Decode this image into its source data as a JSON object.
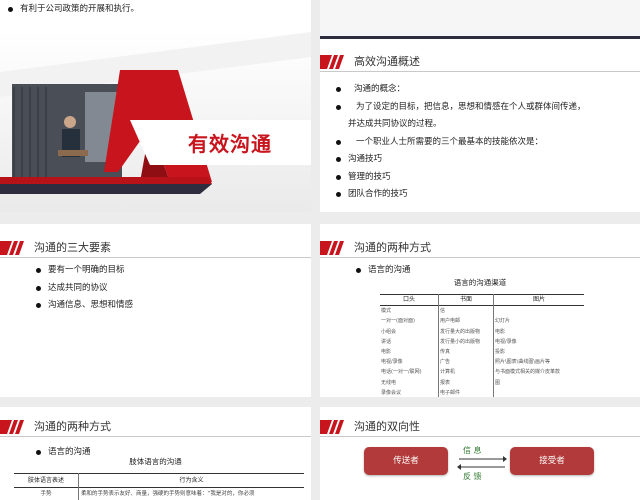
{
  "colors": {
    "accent": "#c8141c",
    "dark": "#2d2d3f",
    "button": "#b23a3a",
    "arrow": "#2f7a2f"
  },
  "s1": {
    "bullet": "有利于公司政策的开展和执行。"
  },
  "s2": {
    "title": "有效沟通"
  },
  "s3": {
    "title": "高效沟通概述",
    "lines": [
      "沟通的概念：",
      "为了设定的目标，把信息，思想和情感在个人或群体间传递，",
      "并达成共同协议的过程。",
      "一个职业人士所需要的三个最基本的技能依次是：",
      "沟通技巧",
      "管理的技巧",
      "团队合作的技巧"
    ]
  },
  "s4": {
    "title": "沟通的三大要素",
    "items": [
      "要有一个明确的目标",
      "达成共同的协议",
      "沟通信息、思想和情感"
    ]
  },
  "s5": {
    "title": "沟通的两种方式",
    "bullet": "语言的沟通",
    "table_title": "语言的沟通渠道",
    "headers": [
      "口头",
      "书面",
      "图片"
    ],
    "rows": [
      [
        "模式",
        "信",
        ""
      ],
      [
        "一对一(面对面)",
        "用户电邮",
        "幻灯片"
      ],
      [
        "小组会",
        "发行量大的出版物",
        "电影"
      ],
      [
        "讲话",
        "发行量小的出版物",
        "电视/录像"
      ],
      [
        "电影",
        "传真",
        "投影"
      ],
      [
        "电视/录像",
        "广告",
        "照片\\图表\\曲线图\\画片等"
      ],
      [
        "电话(一对一/联网)",
        "计算机",
        "与书面模式相关的媒介皮革款"
      ],
      [
        "无线电",
        "报表",
        "图"
      ],
      [
        "录像会议",
        "电子邮件",
        ""
      ]
    ]
  },
  "s6": {
    "title": "沟通的两种方式",
    "bullet": "语言的沟通",
    "table_title": "肢体语言的沟通",
    "headers": [
      "肢体语言表述",
      "行为含义"
    ],
    "rows": [
      [
        "手势",
        "柔和的手势表示友好、商量，强硬的手势则意味着：“我是对的，你必须"
      ]
    ]
  },
  "s7": {
    "title": "沟通的双向性",
    "sender": "传送者",
    "receiver": "接受者",
    "info": "信 息",
    "feedback": "反 馈"
  }
}
